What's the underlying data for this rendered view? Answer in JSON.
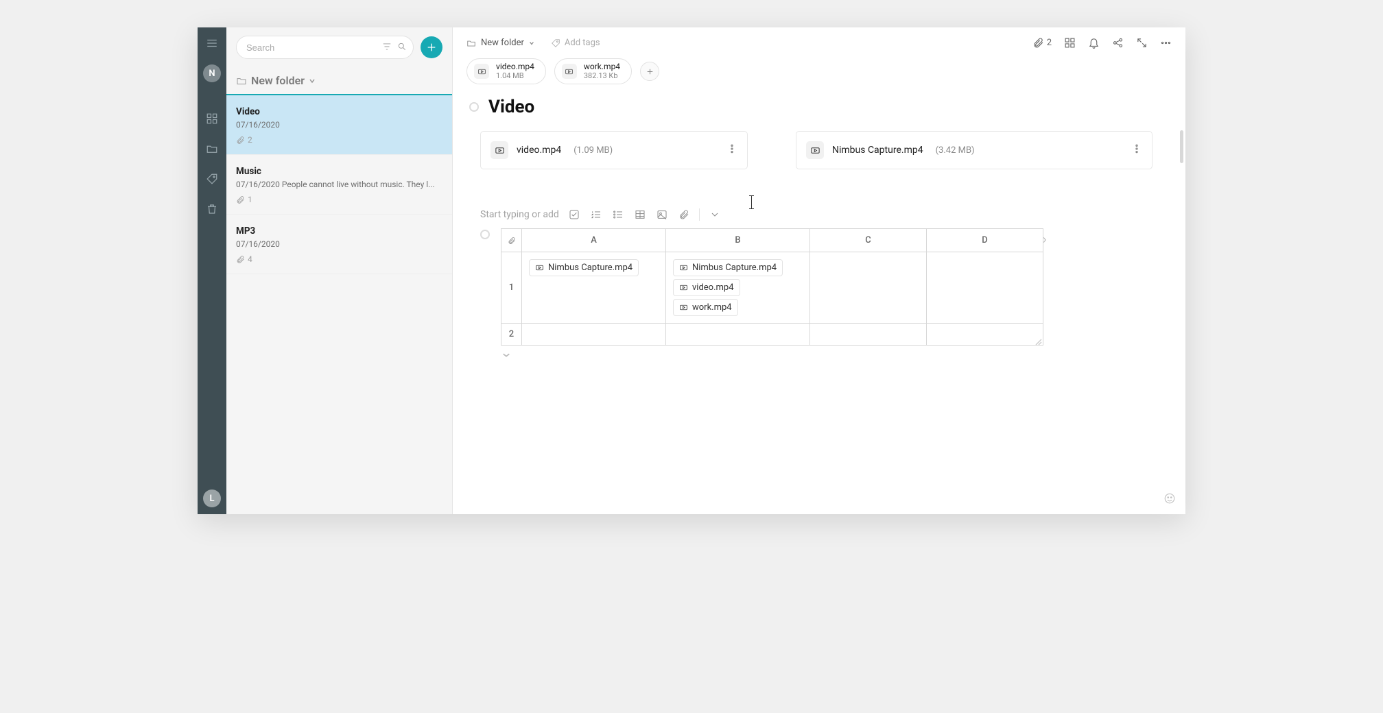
{
  "search": {
    "placeholder": "Search"
  },
  "avatar_top": "N",
  "avatar_bottom": "L",
  "folder_header": "New folder",
  "notes": [
    {
      "title": "Video",
      "meta": "07/16/2020",
      "attach": "2",
      "active": true
    },
    {
      "title": "Music",
      "meta": "07/16/2020 People cannot live without music. They l...",
      "attach": "1",
      "active": false
    },
    {
      "title": "MP3",
      "meta": "07/16/2020",
      "attach": "4",
      "active": false
    }
  ],
  "breadcrumb": {
    "folder": "New folder"
  },
  "add_tags_label": "Add tags",
  "header_attach_count": "2",
  "chips": [
    {
      "name": "video.mp4",
      "size": "1.04 MB"
    },
    {
      "name": "work.mp4",
      "size": "382.13 Kb"
    }
  ],
  "page_title": "Video",
  "files": [
    {
      "name": "video.mp4",
      "size": "(1.09 MB)"
    },
    {
      "name": "Nimbus Capture.mp4",
      "size": "(3.42 MB)"
    }
  ],
  "placeholder_text": "Start typing or add",
  "table": {
    "cols": [
      "A",
      "B",
      "C",
      "D"
    ],
    "rows": [
      "1",
      "2"
    ],
    "cellA1": "Nimbus Capture.mp4",
    "cellB1a": "Nimbus Capture.mp4",
    "cellB1b": "video.mp4",
    "cellB1c": "work.mp4"
  }
}
